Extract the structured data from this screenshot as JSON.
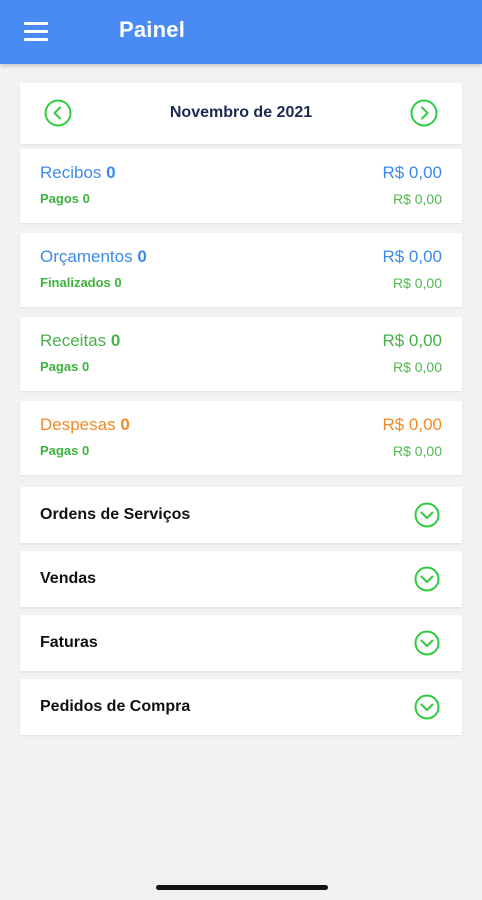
{
  "appbar": {
    "title": "Painel",
    "menu_icon": "hamburger-menu-icon"
  },
  "month_nav": {
    "title": "Novembro de 2021",
    "prev_icon": "chevron-left-circle-icon",
    "next_icon": "chevron-right-circle-icon"
  },
  "summary": [
    {
      "label": "Recibos",
      "count": "0",
      "amount": "R$ 0,00",
      "sub_label": "Pagos",
      "sub_count": "0",
      "sub_amount": "R$ 0,00",
      "color": "#3d8be8"
    },
    {
      "label": "Orçamentos",
      "count": "0",
      "amount": "R$ 0,00",
      "sub_label": "Finalizados",
      "sub_count": "0",
      "sub_amount": "R$ 0,00",
      "color": "#3d8be8"
    },
    {
      "label": "Receitas",
      "count": "0",
      "amount": "R$ 0,00",
      "sub_label": "Pagas",
      "sub_count": "0",
      "sub_amount": "R$ 0,00",
      "color": "#48b048"
    },
    {
      "label": "Despesas",
      "count": "0",
      "amount": "R$ 0,00",
      "sub_label": "Pagas",
      "sub_count": "0",
      "sub_amount": "R$ 0,00",
      "color": "#ef8a25"
    }
  ],
  "sections": [
    {
      "label": "Ordens de Serviços",
      "icon": "chevron-down-circle-icon"
    },
    {
      "label": "Vendas",
      "icon": "chevron-down-circle-icon"
    },
    {
      "label": "Faturas",
      "icon": "chevron-down-circle-icon"
    },
    {
      "label": "Pedidos de Compra",
      "icon": "chevron-down-circle-icon"
    }
  ],
  "colors": {
    "appbar": "#4a8af4",
    "accent_green": "#2ecc40",
    "background": "#f2f2f2"
  }
}
